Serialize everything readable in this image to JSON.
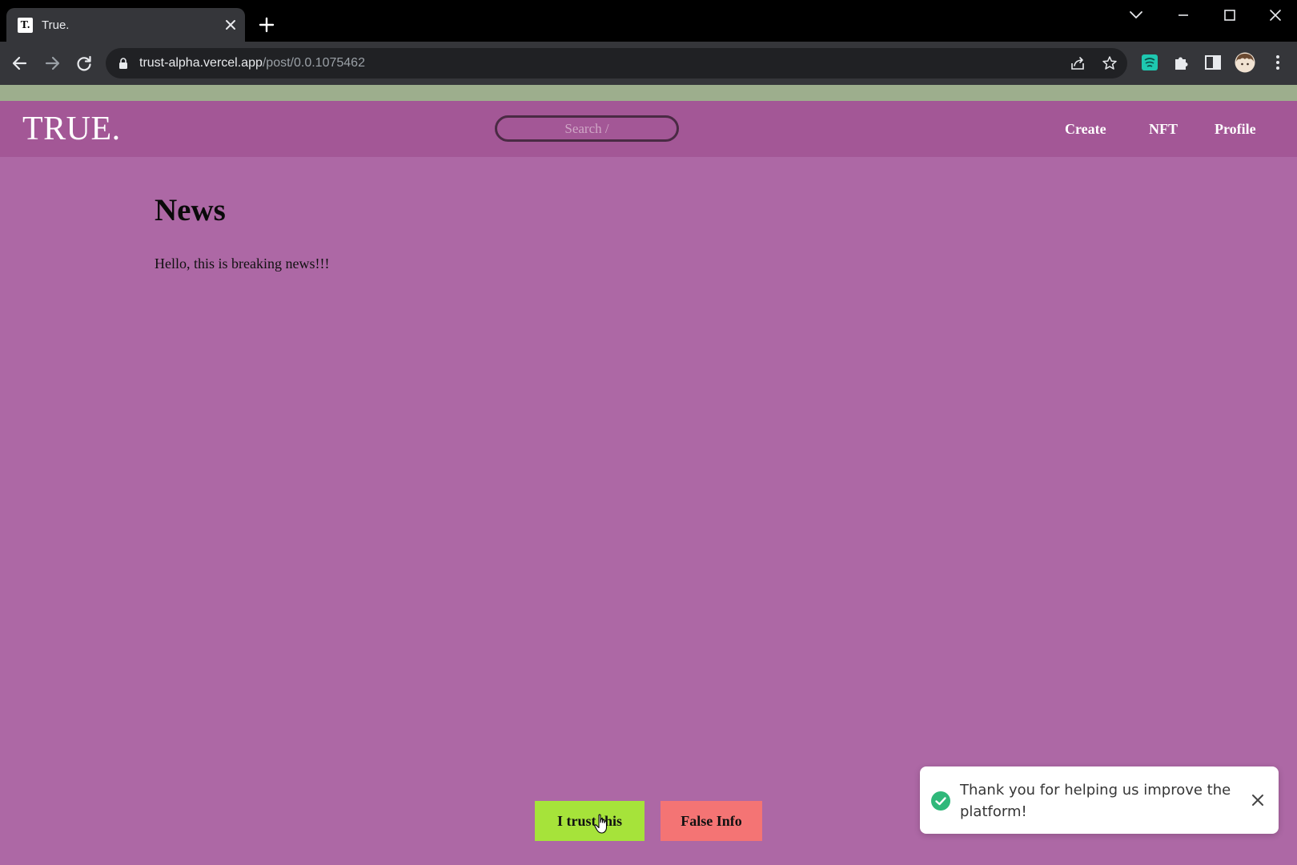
{
  "browser": {
    "tab": {
      "favicon_text": "T.",
      "title": "True."
    },
    "url": {
      "host": "trust-alpha.vercel.app",
      "path": "/post/0.0.1075462"
    },
    "icons": [
      "close-icon",
      "plus-icon",
      "chevron-down-icon",
      "minimize-icon",
      "maximize-icon",
      "window-close-icon",
      "back-arrow-icon",
      "forward-arrow-icon",
      "reload-icon",
      "lock-icon",
      "share-icon",
      "star-icon",
      "extension-teal-icon",
      "puzzle-icon",
      "side-panel-icon",
      "avatar",
      "kebab-menu-icon"
    ]
  },
  "site": {
    "logo": "TRUE.",
    "search": {
      "placeholder": "Search /"
    },
    "nav": {
      "create": "Create",
      "nft": "NFT",
      "profile": "Profile"
    },
    "colors": {
      "header": "#a35796",
      "page": "#ad68a5",
      "strip": "#9dae8d",
      "trust": "#a6e33a",
      "false": "#f47474",
      "toast_check": "#2fb87a"
    }
  },
  "post": {
    "title": "News",
    "body": "Hello, this is breaking news!!!"
  },
  "actions": {
    "trust_label": "I trust this",
    "false_label": "False Info"
  },
  "toast": {
    "message": "Thank you for helping us improve the platform!",
    "icon": "check-circle-icon"
  }
}
